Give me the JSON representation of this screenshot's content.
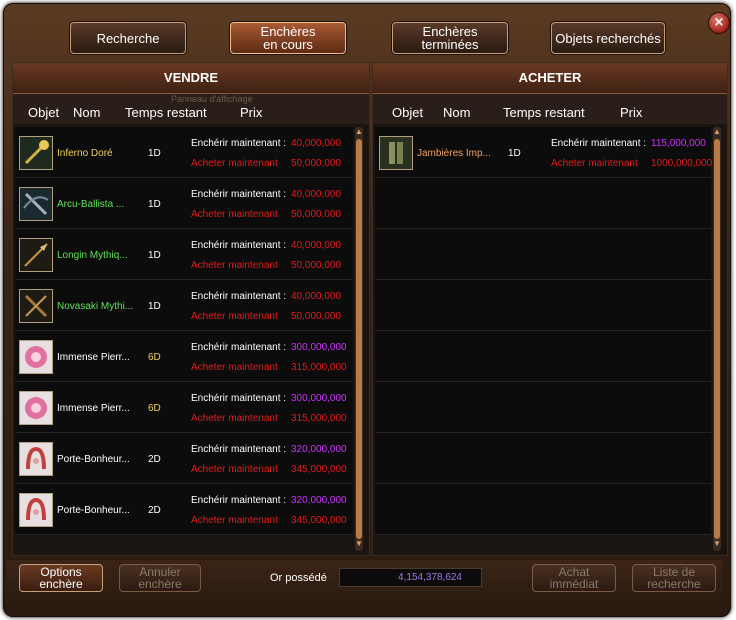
{
  "tabs": [
    {
      "label_1": "Recherche",
      "label_2": ""
    },
    {
      "label_1": "Enchères",
      "label_2": "en cours"
    },
    {
      "label_1": "Enchères",
      "label_2": "terminées"
    },
    {
      "label_1": "Objets recherchés",
      "label_2": ""
    }
  ],
  "sell": {
    "title": "VENDRE",
    "columns": [
      "Objet",
      "Nom",
      "Temps restant",
      "Prix"
    ],
    "faint_text": "Panneau d'affichage",
    "rows": [
      {
        "icon": "golden-staff-icon",
        "name": "Inferno Doré",
        "name_color": "#f0d060",
        "time": "1D",
        "time_color": "#ffffff",
        "bid_label": "Enchérir maintenant :",
        "bid_value": "40,000,000",
        "bid_color": "#e21a1a",
        "buy_label": "Acheter maintenant",
        "buy_value": "50,000,000"
      },
      {
        "icon": "crossbow-icon",
        "name": "Arcu-Ballista ...",
        "name_color": "#5ee05a",
        "time": "1D",
        "time_color": "#ffffff",
        "bid_label": "Enchérir maintenant :",
        "bid_value": "40,000,000",
        "bid_color": "#e21a1a",
        "buy_label": "Acheter maintenant",
        "buy_value": "50,000,000"
      },
      {
        "icon": "spear-icon",
        "name": "Longin Mythiq...",
        "name_color": "#5ee05a",
        "time": "1D",
        "time_color": "#ffffff",
        "bid_label": "Enchérir maintenant :",
        "bid_value": "40,000,000",
        "bid_color": "#e21a1a",
        "buy_label": "Acheter maintenant",
        "buy_value": "50,000,000"
      },
      {
        "icon": "cross-weapon-icon",
        "name": "Novasaki Mythi...",
        "name_color": "#5ee05a",
        "time": "1D",
        "time_color": "#ffffff",
        "bid_label": "Enchérir maintenant :",
        "bid_value": "40,000,000",
        "bid_color": "#e21a1a",
        "buy_label": "Acheter maintenant",
        "buy_value": "50,000,000"
      },
      {
        "icon": "pink-gem-icon",
        "name": "Immense Pierr...",
        "name_color": "#ffffff",
        "time": "6D",
        "time_color": "#f0d060",
        "bid_label": "Enchérir maintenant :",
        "bid_value": "300,000,000",
        "bid_color": "#cc33ff",
        "buy_label": "Acheter maintenant",
        "buy_value": "315,000,000"
      },
      {
        "icon": "pink-gem-icon",
        "name": "Immense Pierr...",
        "name_color": "#ffffff",
        "time": "6D",
        "time_color": "#f0d060",
        "bid_label": "Enchérir maintenant :",
        "bid_value": "300,000,000",
        "bid_color": "#cc33ff",
        "buy_label": "Acheter maintenant",
        "buy_value": "315,000,000"
      },
      {
        "icon": "horseshoe-charm-icon",
        "name": "Porte-Bonheur...",
        "name_color": "#ffffff",
        "time": "2D",
        "time_color": "#ffffff",
        "bid_label": "Enchérir maintenant :",
        "bid_value": "320,000,000",
        "bid_color": "#cc33ff",
        "buy_label": "Acheter maintenant",
        "buy_value": "345,000,000"
      },
      {
        "icon": "horseshoe-charm-icon",
        "name": "Porte-Bonheur...",
        "name_color": "#ffffff",
        "time": "2D",
        "time_color": "#ffffff",
        "bid_label": "Enchérir maintenant :",
        "bid_value": "320,000,000",
        "bid_color": "#cc33ff",
        "buy_label": "Acheter maintenant",
        "buy_value": "345,000,000"
      }
    ]
  },
  "buy": {
    "title": "ACHETER",
    "columns": [
      "Objet",
      "Nom",
      "Temps restant",
      "Prix"
    ],
    "rows": [
      {
        "icon": "armor-leggings-icon",
        "name": "Jambières Imp...",
        "name_color": "#f0a060",
        "time": "1D",
        "time_color": "#ffffff",
        "bid_label": "Enchérir maintenant :",
        "bid_value": "115,000,000",
        "bid_color": "#cc33ff",
        "buy_label": "Acheter maintenant",
        "buy_value": "1000,000,000"
      }
    ]
  },
  "bottom": {
    "options_1": "Options",
    "options_2": "enchère",
    "cancel_1": "Annuler",
    "cancel_2": "enchère",
    "gold_label": "Or possédé",
    "gold_value": "4,154,378,624",
    "buy_now_1": "Achat",
    "buy_now_2": "immédiat",
    "search_list_1": "Liste de",
    "search_list_2": "recherche"
  },
  "close_label": "×"
}
